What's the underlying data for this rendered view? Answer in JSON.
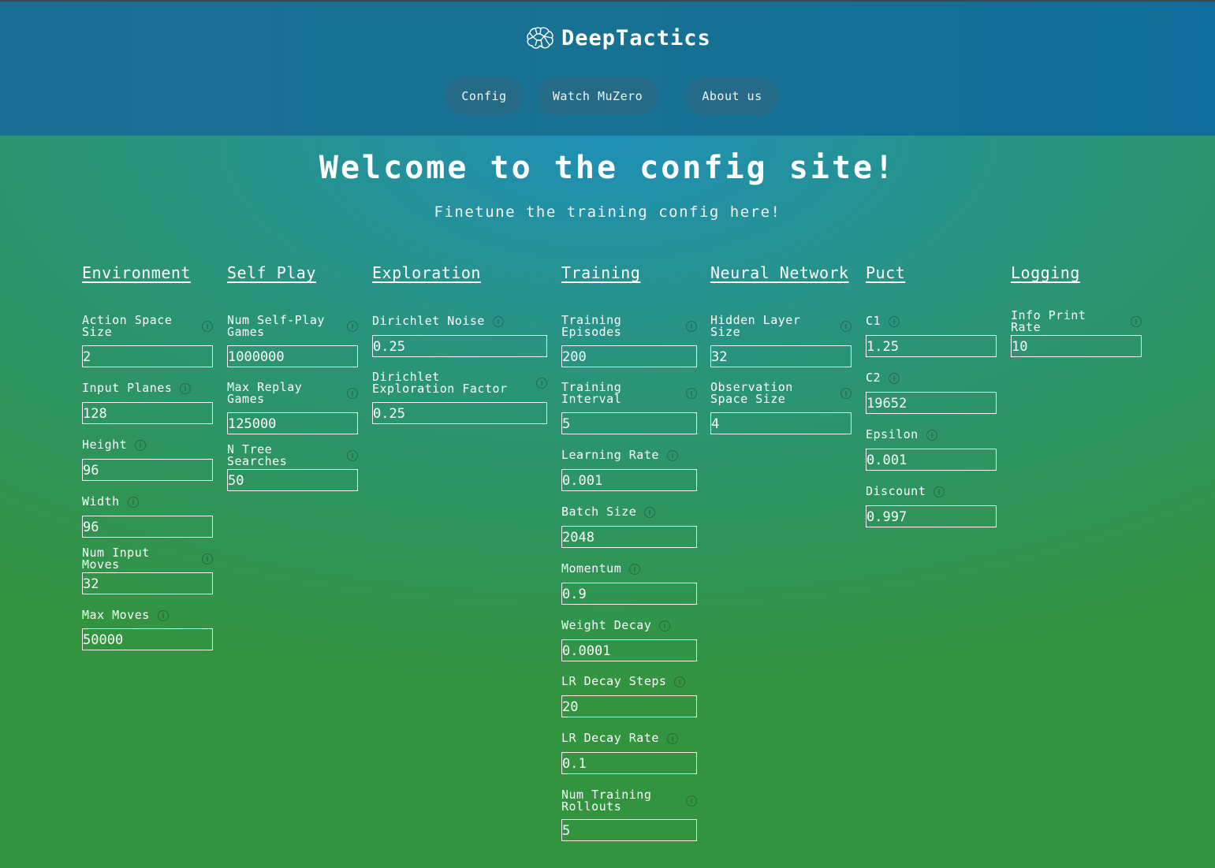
{
  "brand": {
    "name": "DeepTactics",
    "icon": "brain-icon"
  },
  "nav": {
    "config": "Config",
    "watch": "Watch MuZero",
    "about": "About us"
  },
  "page": {
    "title": "Welcome to the config site!",
    "subtitle": "Finetune the training config here!"
  },
  "columns": {
    "environment": {
      "title": "Environment",
      "fields": [
        {
          "label": "Action Space Size",
          "value": "2"
        },
        {
          "label": "Input Planes",
          "value": "128"
        },
        {
          "label": "Height",
          "value": "96"
        },
        {
          "label": "Width",
          "value": "96"
        },
        {
          "label": "Num Input Moves",
          "value": "32"
        },
        {
          "label": "Max Moves",
          "value": "50000"
        }
      ]
    },
    "self_play": {
      "title": "Self Play",
      "fields": [
        {
          "label": "Num Self-Play Games",
          "value": "1000000"
        },
        {
          "label": "Max Replay Games",
          "value": "125000"
        },
        {
          "label": "N Tree Searches",
          "value": "50"
        }
      ]
    },
    "exploration": {
      "title": "Exploration",
      "fields": [
        {
          "label": "Dirichlet Noise",
          "value": "0.25"
        },
        {
          "label": "Dirichlet Exploration Factor",
          "value": "0.25"
        }
      ]
    },
    "training": {
      "title": "Training",
      "fields": [
        {
          "label": "Training Episodes",
          "value": "200"
        },
        {
          "label": "Training Interval",
          "value": "5"
        },
        {
          "label": "Learning Rate",
          "value": "0.001"
        },
        {
          "label": "Batch Size",
          "value": "2048"
        },
        {
          "label": "Momentum",
          "value": "0.9"
        },
        {
          "label": "Weight Decay",
          "value": "0.0001"
        },
        {
          "label": "LR Decay Steps",
          "value": "20"
        },
        {
          "label": "LR Decay Rate",
          "value": "0.1"
        },
        {
          "label": "Num Training Rollouts",
          "value": "5"
        }
      ]
    },
    "neural_network": {
      "title": "Neural Network",
      "fields": [
        {
          "label": "Hidden Layer Size",
          "value": "32"
        },
        {
          "label": "Observation Space Size",
          "value": "4"
        }
      ]
    },
    "puct": {
      "title": "Puct",
      "fields": [
        {
          "label": "C1",
          "value": "1.25"
        },
        {
          "label": "C2",
          "value": "19652"
        },
        {
          "label": "Epsilon",
          "value": "0.001"
        },
        {
          "label": "Discount",
          "value": "0.997"
        }
      ]
    },
    "logging": {
      "title": "Logging",
      "fields": [
        {
          "label": "Info Print Rate",
          "value": "10"
        }
      ]
    }
  }
}
